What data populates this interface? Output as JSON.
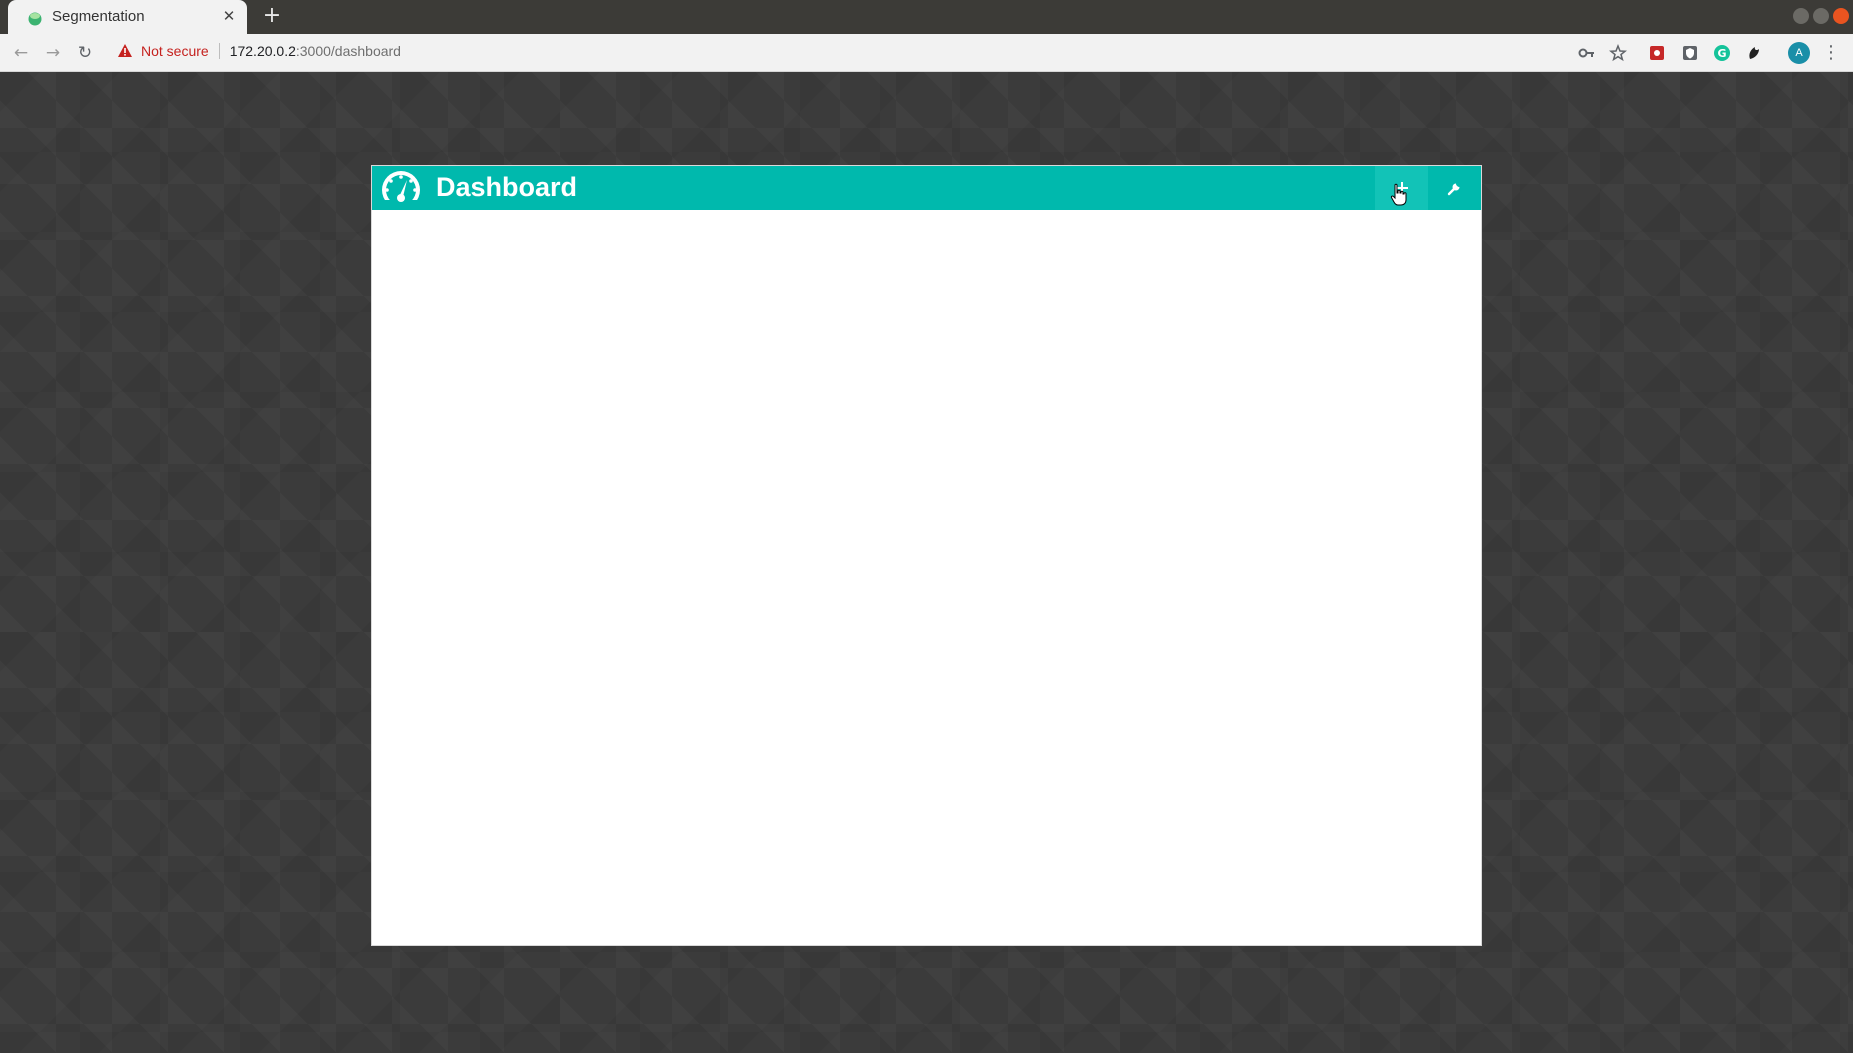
{
  "browser": {
    "tab": {
      "title": "Segmentation",
      "close_label": "✕"
    },
    "new_tab_label": "+",
    "security_label": "Not secure",
    "url": {
      "host": "172.20.0.2",
      "path": ":3000/dashboard"
    },
    "profile_initial": "A"
  },
  "dashboard": {
    "title": "Dashboard",
    "add_icon": "plus-icon",
    "settings_icon": "wrench-icon",
    "header_color": "#00b9ad"
  }
}
